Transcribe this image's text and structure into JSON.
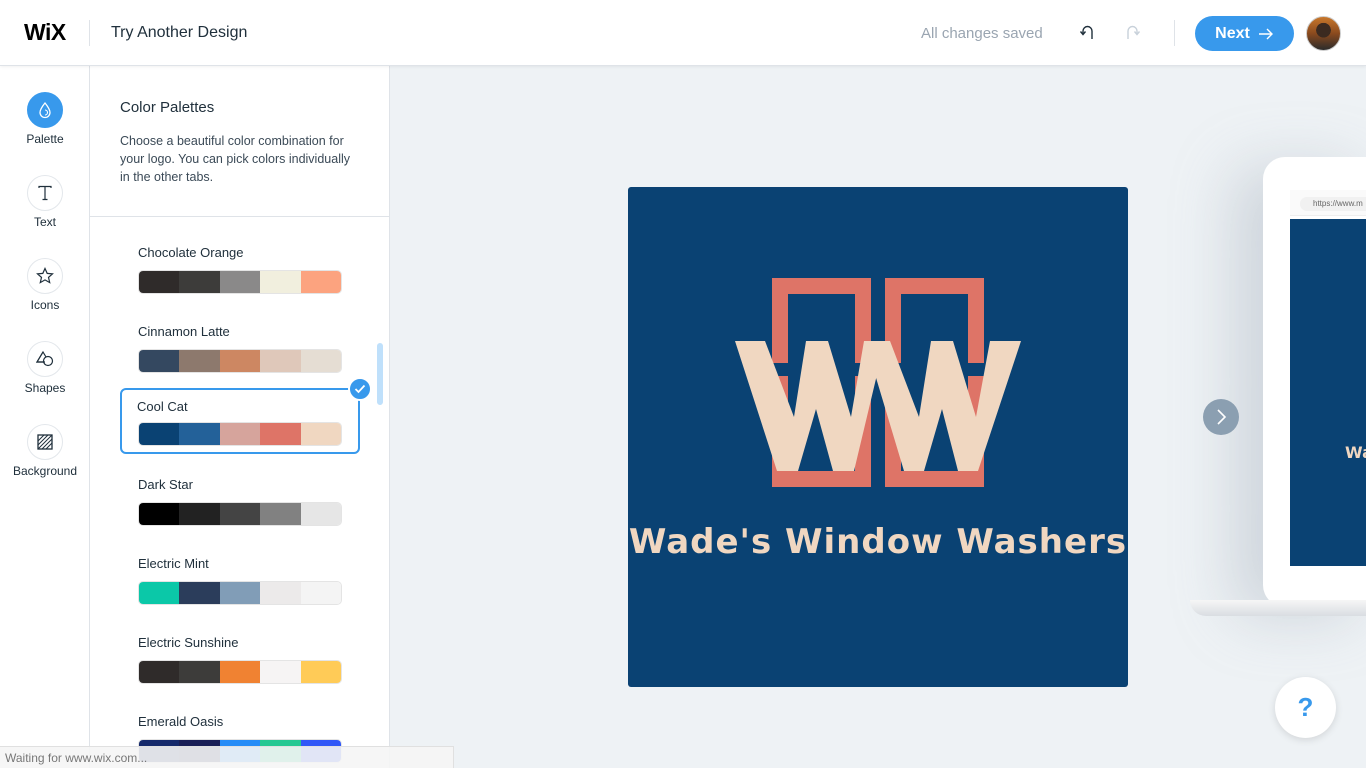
{
  "header": {
    "brand": "WiX",
    "title": "Try Another Design",
    "save_status": "All changes saved",
    "next_label": "Next",
    "undo_icon": "undo-icon",
    "redo_icon": "redo-icon",
    "avatar": "user-avatar"
  },
  "sidebar": {
    "items": [
      {
        "label": "Palette",
        "icon": "droplet-icon",
        "active": true
      },
      {
        "label": "Text",
        "icon": "text-t-icon",
        "active": false
      },
      {
        "label": "Icons",
        "icon": "star-icon",
        "active": false
      },
      {
        "label": "Shapes",
        "icon": "shapes-icon",
        "active": false
      },
      {
        "label": "Background",
        "icon": "hatched-square-icon",
        "active": false
      }
    ]
  },
  "panel": {
    "title": "Color Palettes",
    "description": "Choose a beautiful color combination for your logo. You can pick colors individually in the other tabs.",
    "palettes": [
      {
        "name": "Chocolate Orange",
        "colors": [
          "#2f2b2a",
          "#3d3c3a",
          "#8a8989",
          "#f1efde",
          "#fca37f"
        ],
        "selected": false
      },
      {
        "name": "Cinnamon Latte",
        "colors": [
          "#344860",
          "#8d796d",
          "#cd8762",
          "#dfc8ba",
          "#e5ddd3"
        ],
        "selected": false
      },
      {
        "name": "Cool Cat",
        "colors": [
          "#0a4273",
          "#236199",
          "#d6a49c",
          "#de7467",
          "#f0d7c1"
        ],
        "selected": true
      },
      {
        "name": "Dark Star",
        "colors": [
          "#000000",
          "#222222",
          "#444444",
          "#818181",
          "#e6e6e6"
        ],
        "selected": false
      },
      {
        "name": "Electric Mint",
        "colors": [
          "#0bc8a8",
          "#2b3d5b",
          "#819db7",
          "#eceaea",
          "#f4f4f4"
        ],
        "selected": false
      },
      {
        "name": "Electric Sunshine",
        "colors": [
          "#2f2b2a",
          "#3d3c3a",
          "#f08232",
          "#f6f4f4",
          "#ffcb57"
        ],
        "selected": false
      },
      {
        "name": "Emerald Oasis",
        "colors": [
          "#15296b",
          "#1a1f56",
          "#258cf7",
          "#24c892",
          "#3057f7"
        ],
        "selected": false
      }
    ]
  },
  "status_bar": {
    "text": "Waiting for www.wix.com..."
  },
  "preview": {
    "business_name": "Wade's Window Washers",
    "laptop_url": "https://www.m",
    "laptop_text": "Wa",
    "colors": {
      "background": "#0a4273",
      "frame": "#de7467",
      "letters": "#f0d7c1"
    }
  },
  "help": {
    "label": "?"
  }
}
